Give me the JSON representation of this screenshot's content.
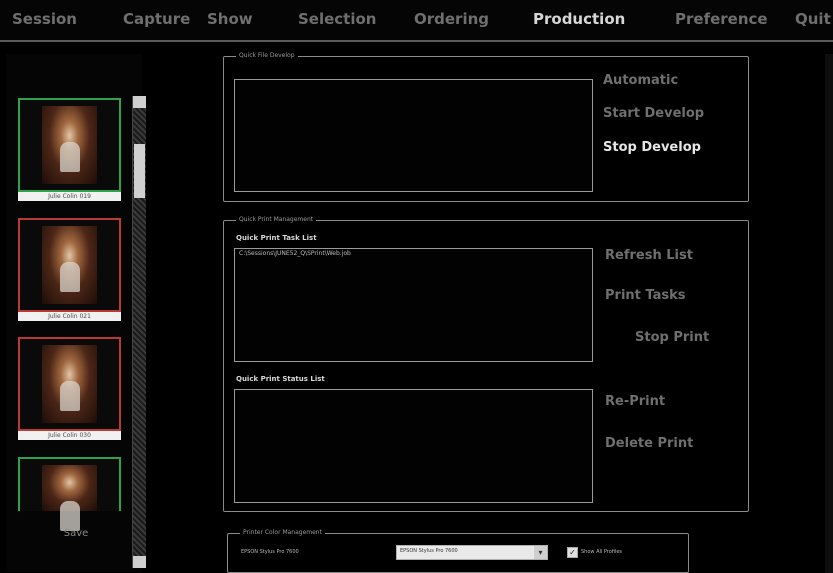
{
  "menu": {
    "items": [
      {
        "label": "Session",
        "active": false
      },
      {
        "label": "Capture",
        "active": false
      },
      {
        "label": "Show",
        "active": false
      },
      {
        "label": "Selection",
        "active": false
      },
      {
        "label": "Ordering",
        "active": false
      },
      {
        "label": "Production",
        "active": true
      },
      {
        "label": "Preference",
        "active": false
      },
      {
        "label": "Quit",
        "active": false
      }
    ]
  },
  "filmstrip": {
    "thumbnails": [
      {
        "caption": "Julie Colin 019",
        "border": "green"
      },
      {
        "caption": "Julie Colin 021",
        "border": "red"
      },
      {
        "caption": "Julie Colin 030",
        "border": "red"
      },
      {
        "caption": "",
        "border": "green"
      }
    ],
    "save_label": "Save"
  },
  "quick_develop": {
    "legend": "Quick File Develop",
    "actions": {
      "automatic": "Automatic",
      "start": "Start Develop",
      "stop": "Stop Develop"
    }
  },
  "quick_print": {
    "legend": "Quick Print Management",
    "task_list_label": "Quick Print Task List",
    "task_items": [
      "C:\\Sessions\\JUNE52_Q\\SPrint\\Web.job"
    ],
    "status_list_label": "Quick Print Status List",
    "status_items": [],
    "actions": {
      "refresh": "Refresh List",
      "print_tasks": "Print Tasks",
      "stop_print": "Stop Print",
      "reprint": "Re-Print",
      "delete_print": "Delete Print"
    }
  },
  "color_mgmt": {
    "legend": "Printer Color Management",
    "printer_label": "EPSON Stylus Pro 7600",
    "selected_printer": "EPSON Stylus Pro 7600",
    "show_all_label": "Show All Profiles",
    "show_all_checked": true
  },
  "colors": {
    "background": "#000000",
    "active_menu": "#d6d6d6",
    "inactive_menu": "#6f6f6f",
    "thumb_selected": "#2ea24a",
    "thumb_other": "#b83a32"
  }
}
